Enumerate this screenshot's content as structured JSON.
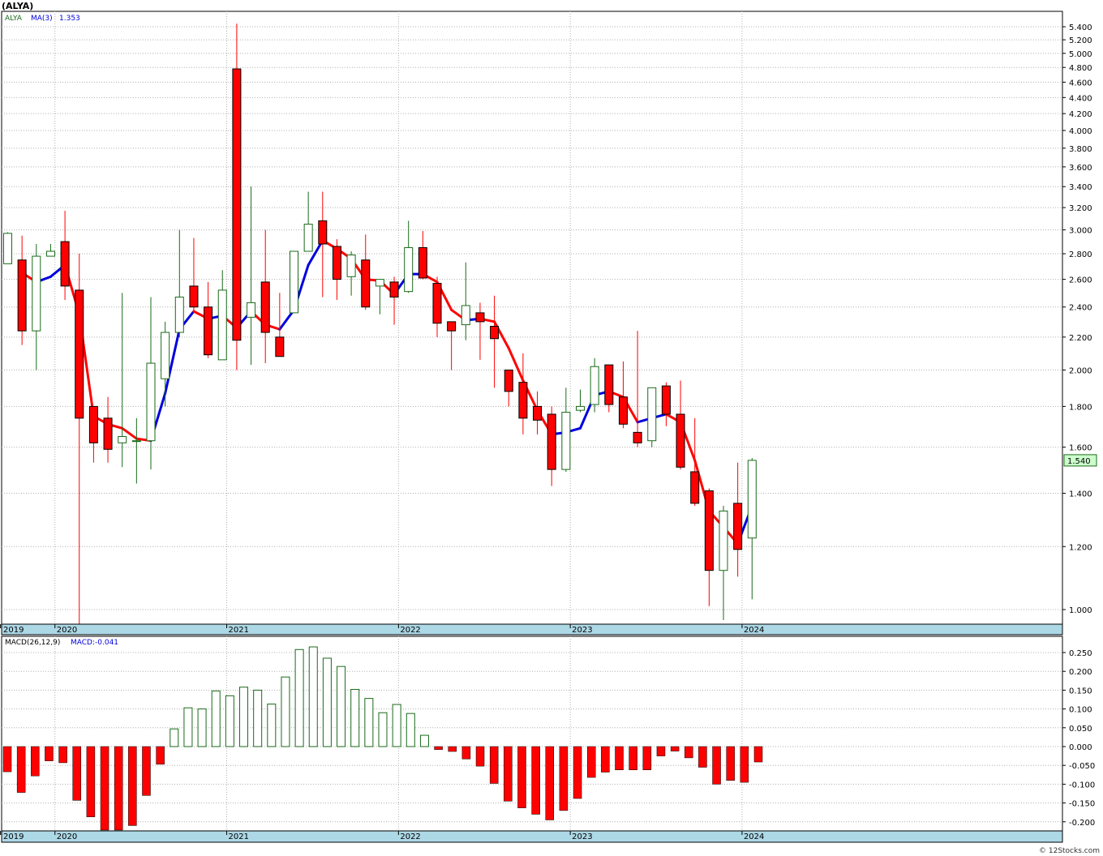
{
  "title": "(ALYA)",
  "legend": {
    "symbol": "ALYA",
    "ma_label": "MA(3)",
    "ma_value": "1.353"
  },
  "macd_legend": {
    "label": "MACD(26,12,9)",
    "value": "MACD:-0.041"
  },
  "last_price_label": "1.540",
  "credit": "© 12Stocks.com",
  "colors": {
    "up": "#1a6b1a",
    "down": "#ff0000",
    "ma_up": "#0000dd",
    "ma_down": "#ff0000",
    "axis_band": "#add8e6"
  },
  "chart_data": [
    {
      "type": "candlestick",
      "y_scale": "log",
      "ylim": [
        0.95,
        5.5
      ],
      "y_ticks": [
        "5.400",
        "5.200",
        "5.000",
        "4.800",
        "4.600",
        "4.400",
        "4.200",
        "4.000",
        "3.800",
        "3.600",
        "3.400",
        "3.200",
        "3.000",
        "2.800",
        "2.600",
        "2.400",
        "2.200",
        "2.000",
        "1.800",
        "1.600",
        "1.400",
        "1.200",
        "1.000"
      ],
      "x_labels": [
        "2019",
        "2020",
        "2021",
        "2022",
        "2023",
        "2024"
      ],
      "candles": [
        {
          "o": 2.72,
          "h": 2.98,
          "l": 2.72,
          "c": 2.97
        },
        {
          "o": 2.75,
          "h": 2.95,
          "l": 2.15,
          "c": 2.24
        },
        {
          "o": 2.24,
          "h": 2.88,
          "l": 2.0,
          "c": 2.78
        },
        {
          "o": 2.78,
          "h": 2.88,
          "l": 2.78,
          "c": 2.82
        },
        {
          "o": 2.9,
          "h": 3.17,
          "l": 2.45,
          "c": 2.55
        },
        {
          "o": 2.52,
          "h": 2.8,
          "l": 0.95,
          "c": 1.74
        },
        {
          "o": 1.8,
          "h": 1.8,
          "l": 1.53,
          "c": 1.62
        },
        {
          "o": 1.74,
          "h": 1.85,
          "l": 1.53,
          "c": 1.59
        },
        {
          "o": 1.62,
          "h": 2.5,
          "l": 1.51,
          "c": 1.65
        },
        {
          "o": 1.63,
          "h": 1.74,
          "l": 1.44,
          "c": 1.63
        },
        {
          "o": 1.63,
          "h": 2.47,
          "l": 1.5,
          "c": 2.04
        },
        {
          "o": 1.95,
          "h": 2.3,
          "l": 1.8,
          "c": 2.23
        },
        {
          "o": 2.23,
          "h": 3.0,
          "l": 2.2,
          "c": 2.47
        },
        {
          "o": 2.55,
          "h": 2.93,
          "l": 2.36,
          "c": 2.4
        },
        {
          "o": 2.4,
          "h": 2.58,
          "l": 2.07,
          "c": 2.09
        },
        {
          "o": 2.06,
          "h": 2.67,
          "l": 2.06,
          "c": 2.52
        },
        {
          "o": 4.78,
          "h": 5.45,
          "l": 2.0,
          "c": 2.18
        },
        {
          "o": 2.33,
          "h": 3.4,
          "l": 2.03,
          "c": 2.43
        },
        {
          "o": 2.58,
          "h": 3.0,
          "l": 2.04,
          "c": 2.23
        },
        {
          "o": 2.2,
          "h": 2.5,
          "l": 2.08,
          "c": 2.08
        },
        {
          "o": 2.36,
          "h": 2.82,
          "l": 2.36,
          "c": 2.82
        },
        {
          "o": 2.82,
          "h": 3.35,
          "l": 2.82,
          "c": 3.05
        },
        {
          "o": 3.08,
          "h": 3.35,
          "l": 2.47,
          "c": 2.88
        },
        {
          "o": 2.86,
          "h": 2.92,
          "l": 2.45,
          "c": 2.6
        },
        {
          "o": 2.62,
          "h": 2.82,
          "l": 2.48,
          "c": 2.79
        },
        {
          "o": 2.75,
          "h": 2.96,
          "l": 2.38,
          "c": 2.4
        },
        {
          "o": 2.55,
          "h": 2.58,
          "l": 2.35,
          "c": 2.6
        },
        {
          "o": 2.58,
          "h": 2.62,
          "l": 2.28,
          "c": 2.47
        },
        {
          "o": 2.51,
          "h": 3.08,
          "l": 2.5,
          "c": 2.85
        },
        {
          "o": 2.85,
          "h": 2.99,
          "l": 2.6,
          "c": 2.61
        },
        {
          "o": 2.57,
          "h": 2.62,
          "l": 2.2,
          "c": 2.29
        },
        {
          "o": 2.3,
          "h": 2.3,
          "l": 2.0,
          "c": 2.24
        },
        {
          "o": 2.28,
          "h": 2.73,
          "l": 2.18,
          "c": 2.41
        },
        {
          "o": 2.36,
          "h": 2.43,
          "l": 2.06,
          "c": 2.3
        },
        {
          "o": 2.27,
          "h": 2.48,
          "l": 1.9,
          "c": 2.19
        },
        {
          "o": 2.0,
          "h": 2.0,
          "l": 1.8,
          "c": 1.88
        },
        {
          "o": 1.93,
          "h": 2.1,
          "l": 1.66,
          "c": 1.74
        },
        {
          "o": 1.8,
          "h": 1.88,
          "l": 1.66,
          "c": 1.73
        },
        {
          "o": 1.76,
          "h": 1.8,
          "l": 1.43,
          "c": 1.5
        },
        {
          "o": 1.5,
          "h": 1.9,
          "l": 1.49,
          "c": 1.77
        },
        {
          "o": 1.78,
          "h": 1.89,
          "l": 1.77,
          "c": 1.8
        },
        {
          "o": 1.81,
          "h": 2.07,
          "l": 1.77,
          "c": 2.02
        },
        {
          "o": 2.03,
          "h": 2.03,
          "l": 1.77,
          "c": 1.81
        },
        {
          "o": 1.85,
          "h": 2.05,
          "l": 1.69,
          "c": 1.71
        },
        {
          "o": 1.67,
          "h": 2.24,
          "l": 1.6,
          "c": 1.62
        },
        {
          "o": 1.63,
          "h": 1.9,
          "l": 1.6,
          "c": 1.9
        },
        {
          "o": 1.91,
          "h": 1.93,
          "l": 1.7,
          "c": 1.76
        },
        {
          "o": 1.76,
          "h": 1.94,
          "l": 1.5,
          "c": 1.51
        },
        {
          "o": 1.49,
          "h": 1.74,
          "l": 1.35,
          "c": 1.36
        },
        {
          "o": 1.41,
          "h": 1.42,
          "l": 1.01,
          "c": 1.12
        },
        {
          "o": 1.12,
          "h": 1.35,
          "l": 0.97,
          "c": 1.33
        },
        {
          "o": 1.36,
          "h": 1.53,
          "l": 1.1,
          "c": 1.19
        },
        {
          "o": 1.23,
          "h": 1.55,
          "l": 1.03,
          "c": 1.54
        }
      ],
      "ma3": [
        null,
        2.65,
        2.58,
        2.62,
        2.71,
        2.35,
        1.75,
        1.71,
        1.69,
        1.64,
        1.63,
        1.87,
        2.25,
        2.37,
        2.32,
        2.34,
        2.26,
        2.37,
        2.28,
        2.25,
        2.38,
        2.71,
        2.91,
        2.84,
        2.76,
        2.6,
        2.59,
        2.49,
        2.64,
        2.64,
        2.58,
        2.38,
        2.31,
        2.32,
        2.3,
        2.13,
        1.94,
        1.78,
        1.66,
        1.67,
        1.69,
        1.86,
        1.88,
        1.85,
        1.72,
        1.74,
        1.76,
        1.72,
        1.54,
        1.33,
        1.27,
        1.21,
        1.35
      ]
    },
    {
      "type": "bar",
      "name": "MACD(26,12,9)",
      "ylim": [
        -0.225,
        0.27
      ],
      "y_ticks": [
        "0.250",
        "0.200",
        "0.150",
        "0.100",
        "0.050",
        "0.000",
        "-0.050",
        "-0.100",
        "-0.150",
        "-0.200"
      ],
      "values": [
        -0.067,
        -0.122,
        -0.078,
        -0.038,
        -0.043,
        -0.143,
        -0.187,
        -0.225,
        -0.225,
        -0.21,
        -0.13,
        -0.047,
        0.047,
        0.103,
        0.1,
        0.148,
        0.135,
        0.158,
        0.15,
        0.113,
        0.185,
        0.258,
        0.265,
        0.235,
        0.213,
        0.152,
        0.128,
        0.09,
        0.112,
        0.088,
        0.03,
        -0.008,
        -0.013,
        -0.033,
        -0.052,
        -0.098,
        -0.145,
        -0.163,
        -0.18,
        -0.195,
        -0.17,
        -0.138,
        -0.082,
        -0.068,
        -0.062,
        -0.062,
        -0.062,
        -0.025,
        -0.012,
        -0.03,
        -0.055,
        -0.1,
        -0.09,
        -0.095,
        -0.041
      ]
    }
  ]
}
